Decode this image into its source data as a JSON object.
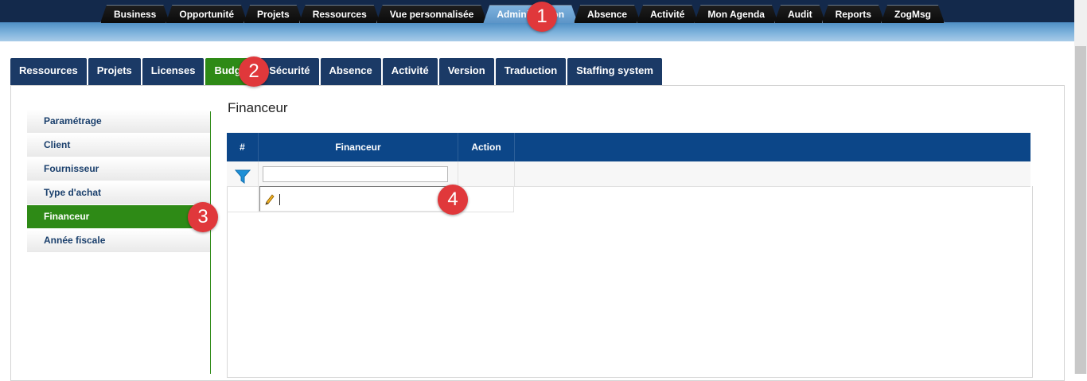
{
  "top_nav": {
    "tabs": [
      "Business",
      "Opportunité",
      "Projets",
      "Ressources",
      "Vue personnalisée",
      "Administration",
      "Absence",
      "Activité",
      "Mon Agenda",
      "Audit",
      "Reports",
      "ZogMsg"
    ],
    "active": "Administration"
  },
  "sub_nav": {
    "tabs": [
      "Ressources",
      "Projets",
      "Licenses",
      "Budget",
      "Sécurité",
      "Absence",
      "Activité",
      "Version",
      "Traduction",
      "Staffing system"
    ],
    "active": "Budget"
  },
  "left_menu": {
    "items": [
      "Paramétrage",
      "Client",
      "Fournisseur",
      "Type d'achat",
      "Financeur",
      "Année fiscale"
    ],
    "active": "Financeur"
  },
  "page": {
    "title": "Financeur"
  },
  "grid": {
    "headers": {
      "index": "#",
      "financeur": "Financeur",
      "action": "Action"
    },
    "filter_value": "",
    "edit_value": ""
  },
  "icons": {
    "filter": "funnel-filter-icon",
    "edit": "pencil-icon"
  },
  "colors": {
    "active_green": "#2e8a16",
    "nav_blue": "#1b3a66",
    "grid_header": "#0c4688",
    "callout_red": "#e0383b"
  },
  "callouts": [
    "1",
    "2",
    "3",
    "4"
  ]
}
